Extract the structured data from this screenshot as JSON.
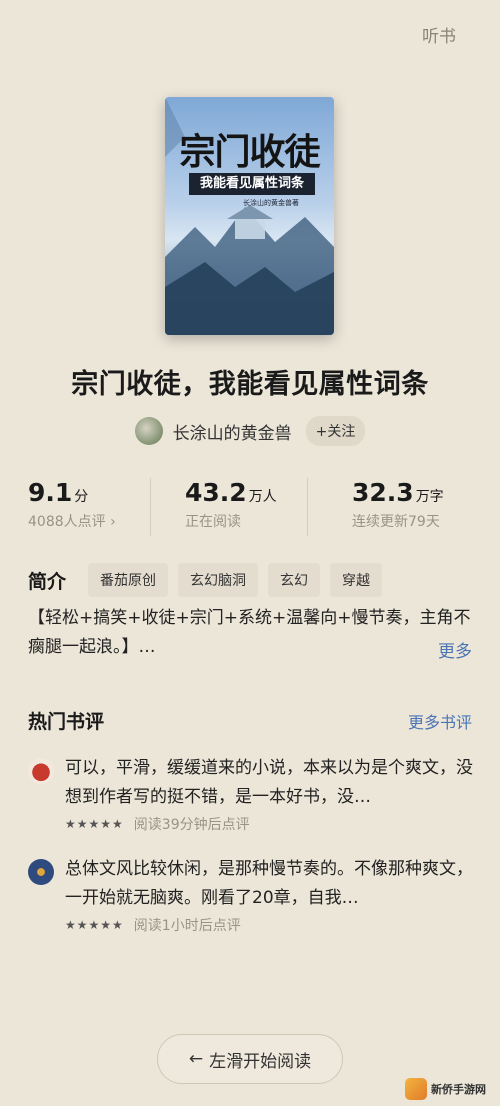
{
  "header": {
    "listen_label": "听书"
  },
  "cover": {
    "title": "宗门收徒",
    "subtitle": "我能看见属性词条",
    "author": "长涂山的黄金兽著"
  },
  "book": {
    "title": "宗门收徒，我能看见属性词条"
  },
  "author": {
    "name": "长涂山的黄金兽",
    "follow_label": "+关注"
  },
  "stats": {
    "rating": {
      "value": "9.1",
      "unit": "分",
      "sub": "4088人点评 ›"
    },
    "readers": {
      "value": "43.2",
      "unit": "万人",
      "sub": "正在阅读"
    },
    "words": {
      "value": "32.3",
      "unit": "万字",
      "sub": "连续更新79天"
    }
  },
  "intro": {
    "label": "简介",
    "tags": [
      "番茄原创",
      "玄幻脑洞",
      "玄幻",
      "穿越"
    ],
    "text": "【轻松+搞笑+收徒+宗门+系统+温馨向+慢节奏，主角不瘸腿一起浪。】…",
    "more_label": "更多"
  },
  "reviews_section": {
    "title": "热门书评",
    "more_label": "更多书评"
  },
  "reviews": [
    {
      "text": "可以，平滑，缓缓道来的小说，本来以为是个爽文，没想到作者写的挺不错，是一本好书，没…",
      "stars": "★★★★★",
      "meta": "阅读39分钟后点评"
    },
    {
      "text": "总体文风比较休闲，是那种慢节奏的。不像那种爽文，一开始就无脑爽。刚看了20章，自我…",
      "stars": "★★★★★",
      "meta": "阅读1小时后点评"
    }
  ],
  "footer": {
    "swipe_label": "左滑开始阅读",
    "arrow_icon": "←"
  },
  "watermark": {
    "text": "新侨手游网"
  }
}
